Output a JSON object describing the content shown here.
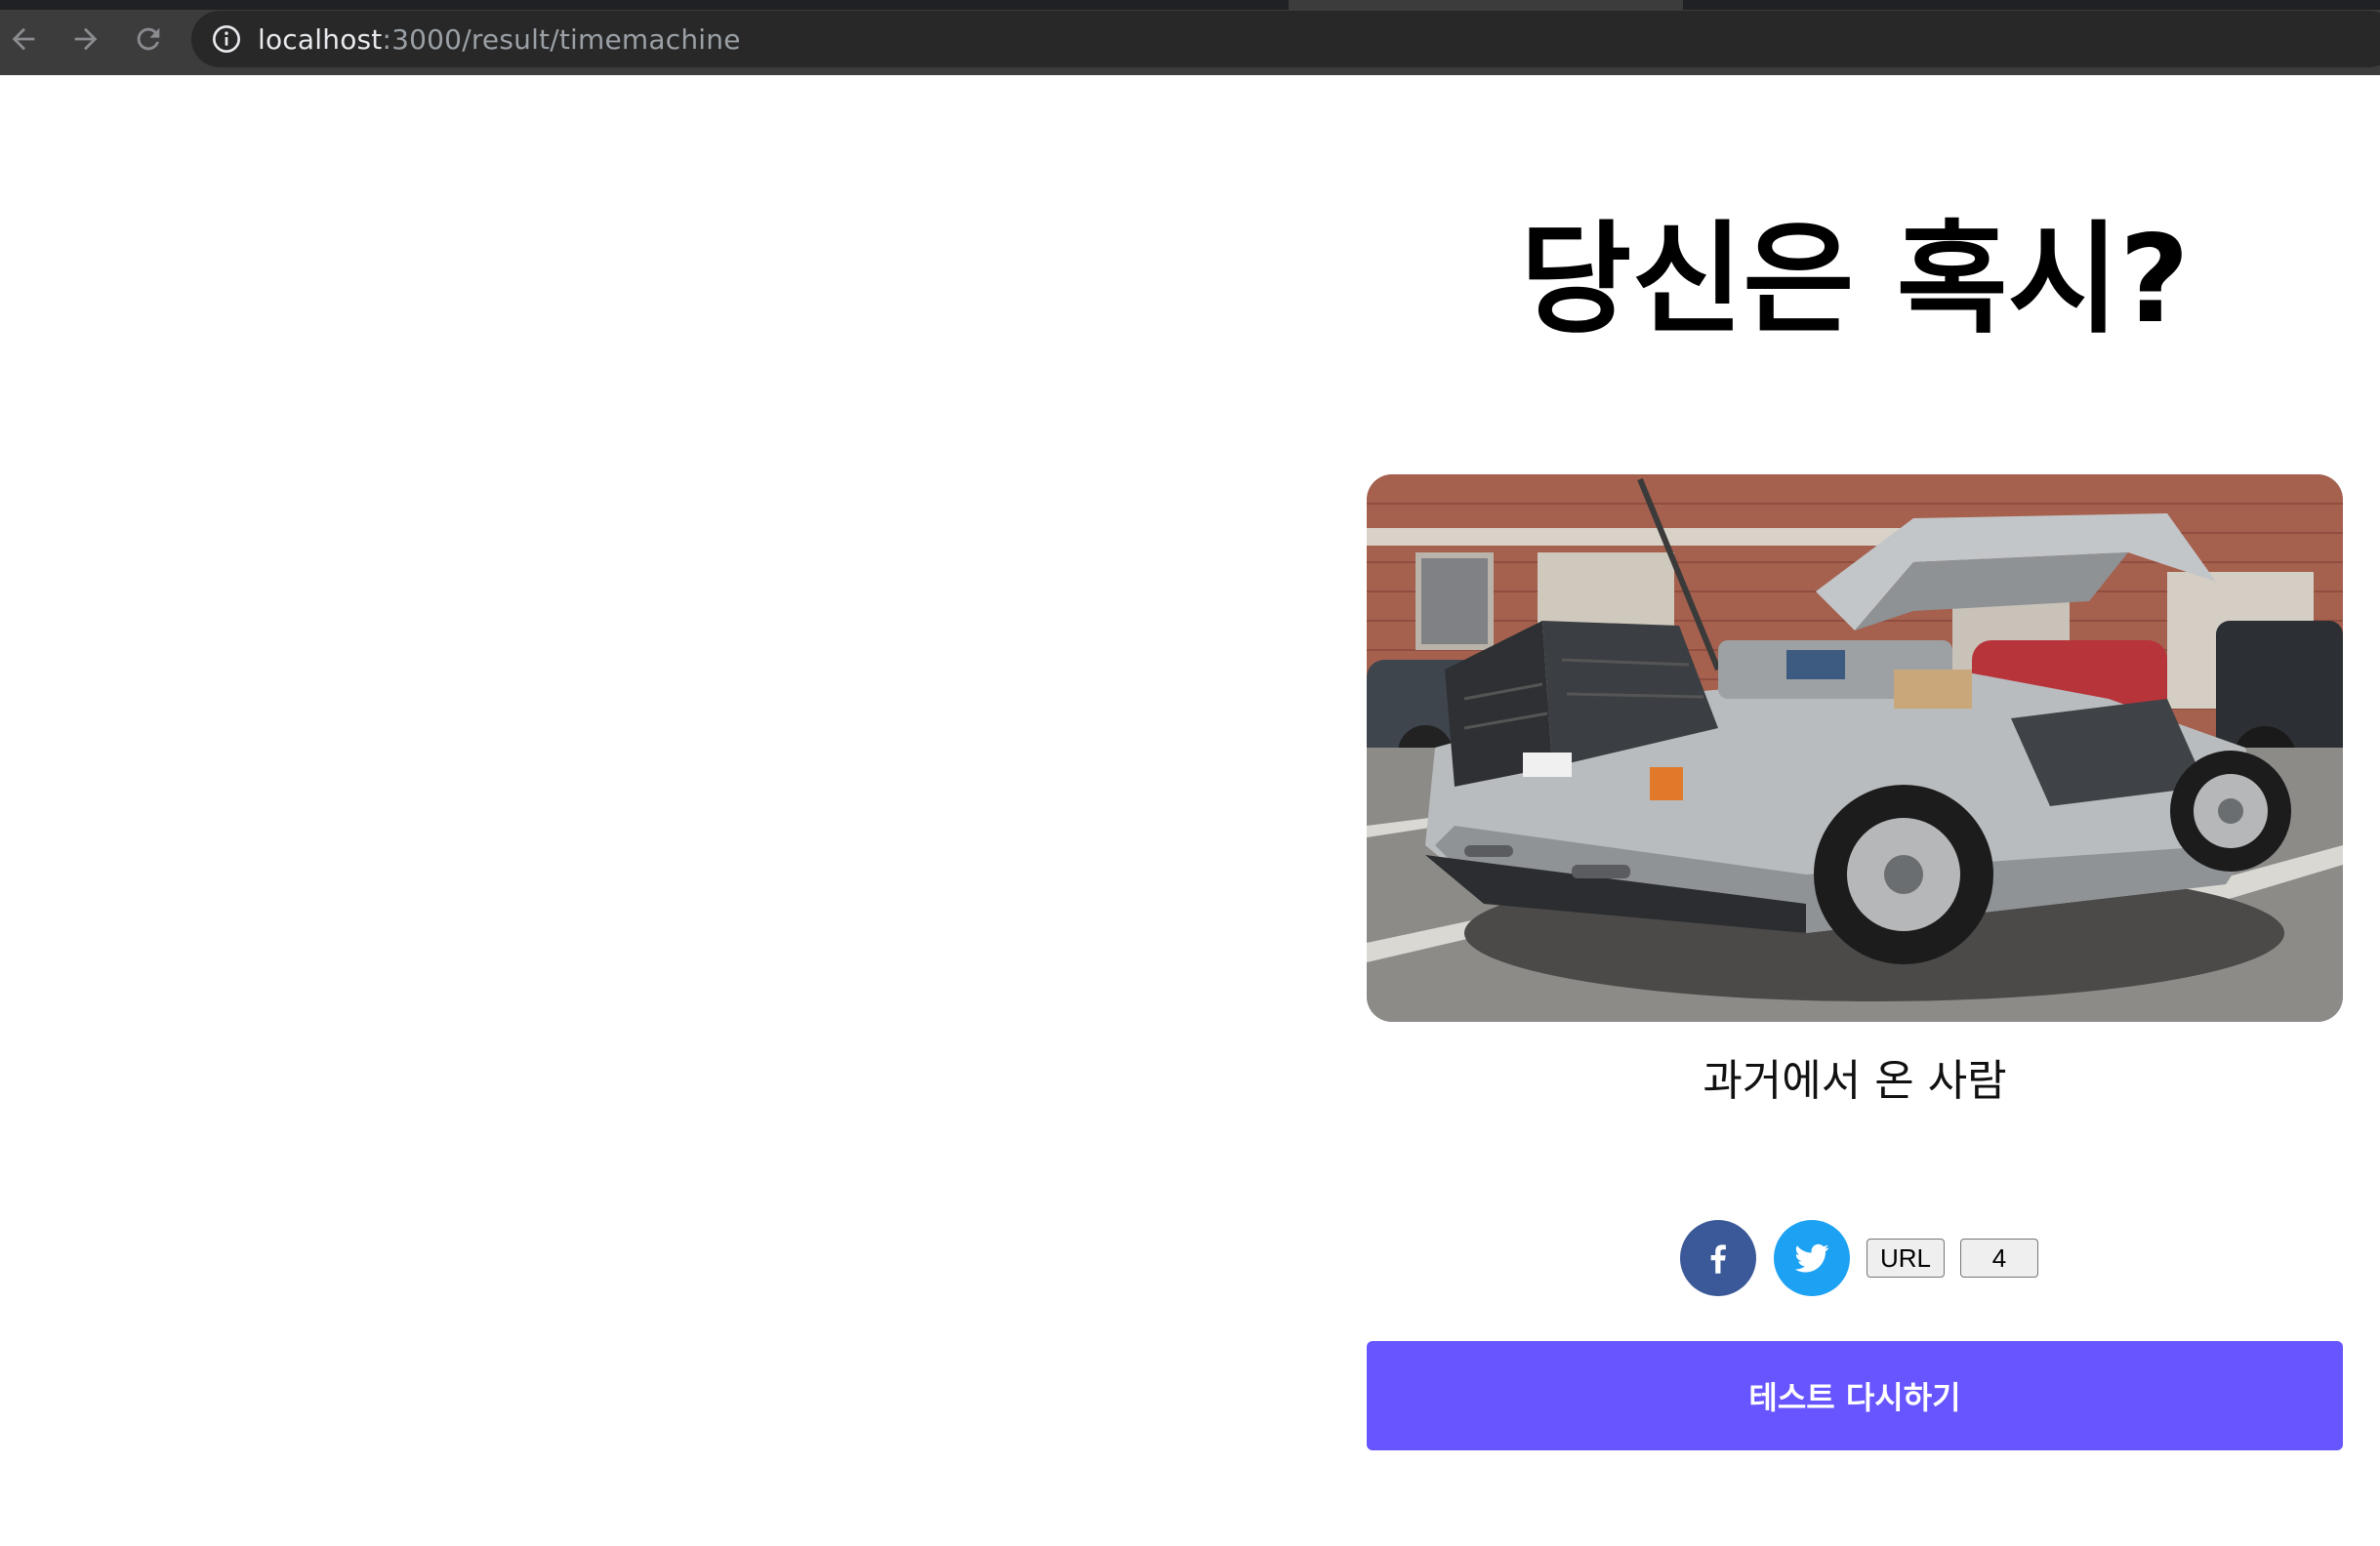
{
  "browser": {
    "url_host": "localhost",
    "url_path": ":3000/result/timemachine",
    "icons": {
      "back": "arrow-left-icon",
      "forward": "arrow-right-icon",
      "reload": "reload-icon",
      "site_info": "info-icon"
    }
  },
  "page": {
    "title": "당신은 혹시?",
    "result_caption": "과거에서 온 사람",
    "share": {
      "facebook_icon": "facebook-icon",
      "twitter_icon": "twitter-icon",
      "url_button": "URL",
      "share_count": "4"
    },
    "retry_button": "테스트 다시하기",
    "colors": {
      "accent": "#6755ff",
      "facebook": "#3b5998",
      "twitter": "#1da1f2"
    }
  }
}
